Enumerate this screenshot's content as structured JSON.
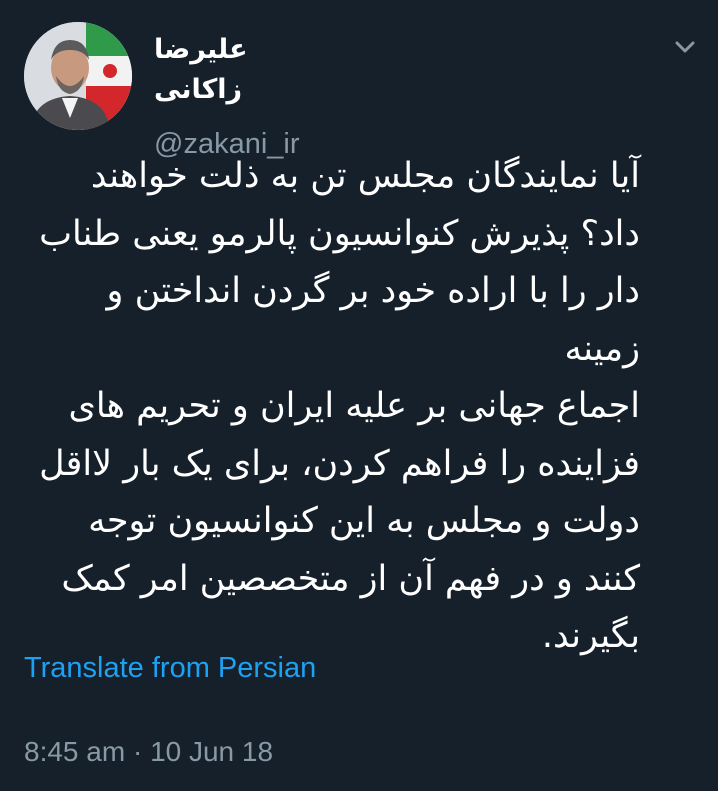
{
  "user": {
    "display_name": "علیرضا زاکانی",
    "handle": "@zakani_ir",
    "avatar": "profile-photo"
  },
  "tweet": {
    "text": "آیا نمایندگان مجلس تن به ذلت خواهند\nداد؟ پذیرش کنوانسیون پالرمو یعنی طناب\nدار را با اراده خود بر گردن انداختن و زمینه\nاجماع جهانی بر علیه ایران و تحریم های\nفزاینده را فراهم کردن، برای یک بار لااقل\nدولت و مجلس به این کنوانسیون توجه\nکنند و در فهم آن از متخصصین امر کمک\nبگیرند.",
    "translate_label": "Translate from Persian",
    "time": "8:45 am",
    "separator": " · ",
    "date": "10 Jun 18"
  },
  "icons": {
    "menu": "chevron-down-icon"
  },
  "colors": {
    "background": "#16202b",
    "text": "#ffffff",
    "secondary_text": "#8899a6",
    "link": "#1da1f2"
  }
}
